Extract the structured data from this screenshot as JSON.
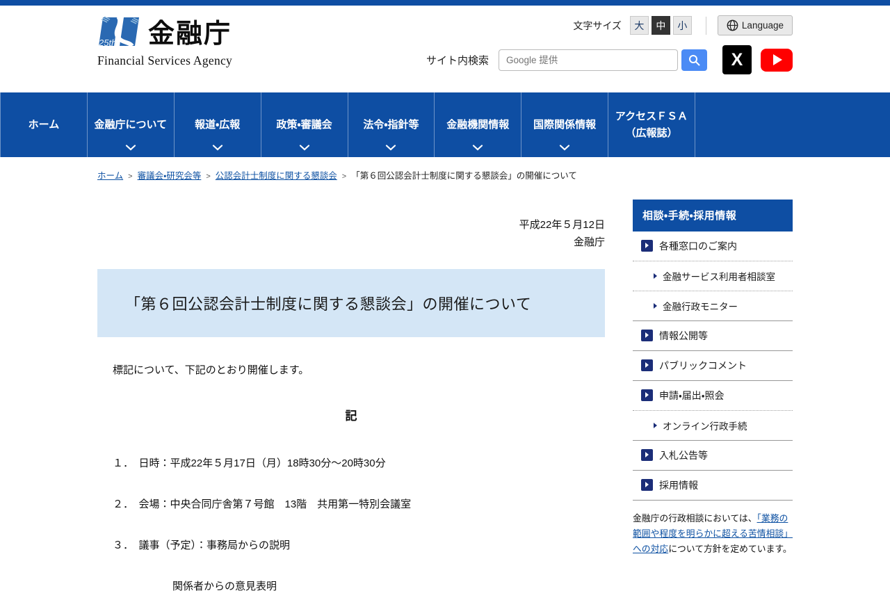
{
  "colors": {
    "primary_blue": "#0e4ea3",
    "navy_icon": "#1b2d78",
    "link_blue": "#0c50a2",
    "title_box_bg": "#d4e6f6",
    "selected_size_bg": "#333333",
    "search_button_blue": "#4b8bf5",
    "youtube_red": "#ff0000",
    "x_black": "#000000"
  },
  "header": {
    "logo": {
      "badge": "25th",
      "title": "金融庁",
      "subtitle": "Financial Services Agency"
    },
    "font_size": {
      "label": "文字サイズ",
      "options": [
        {
          "label": "大",
          "selected": false
        },
        {
          "label": "中",
          "selected": true
        },
        {
          "label": "小",
          "selected": false
        }
      ]
    },
    "language_label": "Language",
    "search": {
      "label": "サイト内検索",
      "placeholder": "Google 提供"
    },
    "social": {
      "x_icon": "X",
      "youtube_icon": "youtube-play"
    }
  },
  "nav": {
    "items": [
      {
        "label": "ホーム",
        "chevron": false
      },
      {
        "label": "金融庁について",
        "chevron": true
      },
      {
        "label": "報道・広報",
        "chevron": true
      },
      {
        "label": "政策・審議会",
        "chevron": true
      },
      {
        "label": "法令・指針等",
        "chevron": true
      },
      {
        "label": "金融機関情報",
        "chevron": true
      },
      {
        "label": "国際関係情報",
        "chevron": true
      },
      {
        "label": "アクセスＦＳＡ\n（広報誌）",
        "chevron": false
      }
    ]
  },
  "breadcrumb": {
    "separator": ">",
    "items": [
      {
        "label": "ホーム",
        "link": true
      },
      {
        "label": "審議会・研究会等",
        "link": true
      },
      {
        "label": "公認会計士制度に関する懇談会",
        "link": true
      },
      {
        "label": "「第６回公認会計士制度に関する懇談会」の開催について",
        "link": false
      }
    ]
  },
  "main": {
    "date": "平成22年５月12日",
    "agency": "金融庁",
    "title": "「第６回公認会計士制度に関する懇談会」の開催について",
    "intro": "標記について、下記のとおり開催します。",
    "ki": "記",
    "items": [
      "１．　日時：平成22年５月17日（月）18時30分～20時30分",
      "２．　会場：中央合同庁舎第７号館　13階　共用第一特別会議室",
      "３．　議事（予定）：事務局からの説明"
    ],
    "item3_cont": "関係者からの意見表明"
  },
  "sidebar": {
    "header": "相談・手続・採用情報",
    "items": [
      {
        "label": "各種窓口のご案内",
        "level": 1,
        "divider": "dotted"
      },
      {
        "label": "金融サービス利用者相談室",
        "level": 2,
        "divider": "dotted"
      },
      {
        "label": "金融行政モニター",
        "level": 2,
        "divider": "solid"
      },
      {
        "label": "情報公開等",
        "level": 1,
        "divider": "solid"
      },
      {
        "label": "パブリックコメント",
        "level": 1,
        "divider": "solid"
      },
      {
        "label": "申請・届出・照会",
        "level": 1,
        "divider": "dotted"
      },
      {
        "label": "オンライン行政手続",
        "level": 2,
        "divider": "solid"
      },
      {
        "label": "入札公告等",
        "level": 1,
        "divider": "solid"
      },
      {
        "label": "採用情報",
        "level": 1,
        "divider": "solid"
      }
    ],
    "note": {
      "pre": "金融庁の行政相談においては、",
      "link": "「業務の範囲や程度を明らかに超える苦情相談」への対応",
      "post": "について方針を定めています。"
    }
  }
}
